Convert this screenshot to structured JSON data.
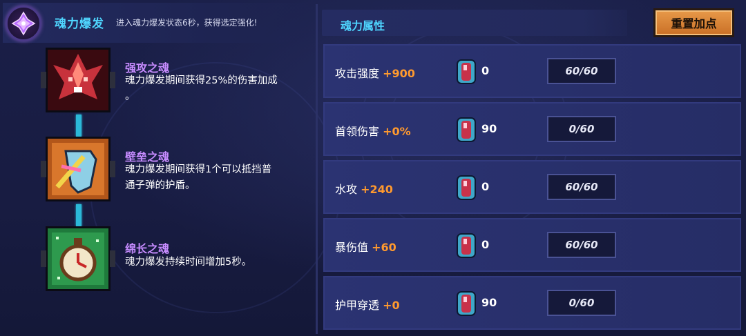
{
  "burst": {
    "title": "魂力爆发",
    "description": "进入魂力爆发状态6秒，获得选定强化!"
  },
  "skills": [
    {
      "name": "强攻之魂",
      "desc_line1": "魂力爆发期间获得25%的伤害加成",
      "desc_line2": "。",
      "icon": "demon-attack-icon"
    },
    {
      "name": "壁垒之魂",
      "desc_line1": "魂力爆发期间获得1个可以抵挡普",
      "desc_line2": "通子弹的护盾。",
      "icon": "shield-barrier-icon"
    },
    {
      "name": "绵长之魂",
      "desc_line1": "魂力爆发持续时间增加5秒。",
      "desc_line2": "",
      "icon": "stopwatch-icon"
    }
  ],
  "attributes": {
    "title": "魂力属性",
    "reset_label": "重置加点",
    "rows": [
      {
        "name": "攻击强度",
        "bonus": "+900",
        "cost": "0",
        "level": "60/60"
      },
      {
        "name": "首领伤害",
        "bonus": "+0%",
        "cost": "90",
        "level": "0/60"
      },
      {
        "name": "水攻",
        "bonus": "+240",
        "cost": "0",
        "level": "60/60"
      },
      {
        "name": "暴伤值",
        "bonus": "+60",
        "cost": "0",
        "level": "60/60"
      },
      {
        "name": "护甲穿透",
        "bonus": "+0",
        "cost": "90",
        "level": "0/60"
      }
    ]
  },
  "colors": {
    "accent_cyan": "#4fd6ff",
    "skill_name_purple": "#c78cff",
    "bonus_orange": "#ff9a2e",
    "button_orange": "#d98034"
  }
}
